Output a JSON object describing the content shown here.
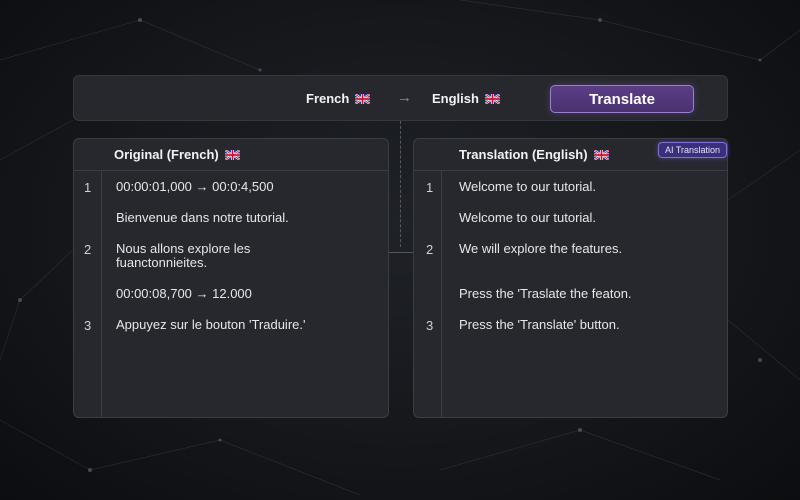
{
  "toolbar": {
    "source_language": "French",
    "target_language": "English",
    "arrow": "→",
    "translate_label": "Translate"
  },
  "original_panel": {
    "title": "Original (French)",
    "rows": [
      {
        "num": "1",
        "text": "00:00:01,000 → 00:0:4,500"
      },
      {
        "num": "",
        "text": "Bienvenue dans notre tutorial."
      },
      {
        "num": "2",
        "text": "Nous allons explore les fuanctonnieites."
      },
      {
        "num": "",
        "text": "00:00:08,700 → 12.000"
      },
      {
        "num": "3",
        "text": "Appuyez sur le bouton 'Traduire.'"
      }
    ]
  },
  "translation_panel": {
    "title": "Translation (English)",
    "badge": "AI Translation",
    "rows": [
      {
        "num": "1",
        "text": "Welcome to our tutorial."
      },
      {
        "num": "",
        "text": "Welcome to our tutorial."
      },
      {
        "num": "2",
        "text": "We will explore the features."
      },
      {
        "num": "",
        "text": "Press the 'Traslate the featon."
      },
      {
        "num": "3",
        "text": "Press the 'Translate' button."
      }
    ]
  },
  "colors": {
    "accent": "#5b3d86",
    "badge": "#3a2f7a",
    "panel": "#26282d"
  },
  "icons": [
    "uk-flag-icon",
    "arrow-right-icon"
  ]
}
